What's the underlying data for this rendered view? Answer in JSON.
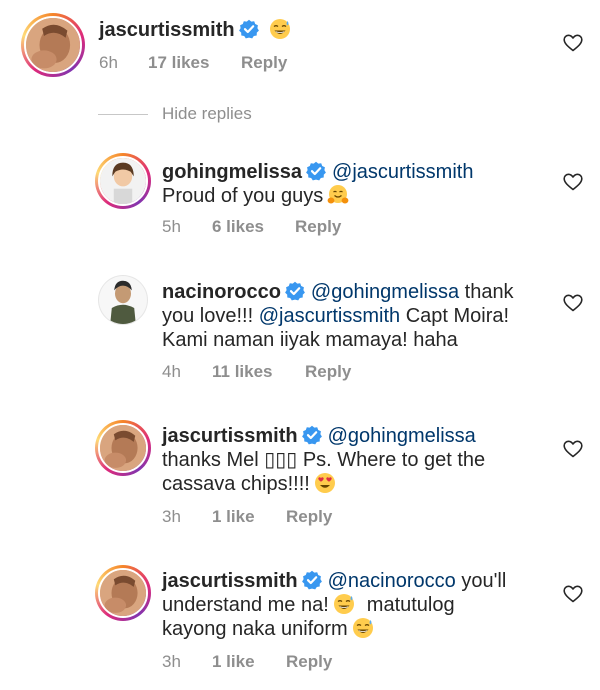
{
  "colors": {
    "text": "#262626",
    "meta": "#8e8e8e",
    "mention": "#00376b",
    "verified": "#3897f0"
  },
  "hide_replies": "Hide replies",
  "top_comment": {
    "username": "jascurtissmith",
    "emoji": "grinning-sweat-emoji",
    "time": "6h",
    "likes": "17 likes",
    "reply": "Reply"
  },
  "replies": [
    {
      "username": "gohingmelissa",
      "mention": "@jascurtissmith",
      "line2": "Proud of you guys",
      "emoji": "hugging-face-emoji",
      "time": "5h",
      "likes": "6 likes",
      "reply": "Reply"
    },
    {
      "username": "nacinorocco",
      "mention": "@gohingmelissa",
      "line1_tail": " thank",
      "line2_pre": "you love!!! ",
      "line2_mention": "@jascurtissmith",
      "line2_tail": " Capt Moira!",
      "line3": "Kami naman iiyak mamaya! haha",
      "time": "4h",
      "likes": "11 likes",
      "reply": "Reply"
    },
    {
      "username": "jascurtissmith",
      "mention": "@gohingmelissa",
      "line2": "thanks Mel ▯▯▯ Ps. Where to get the",
      "line3": "cassava chips!!!!",
      "emoji": "heart-eyes-emoji",
      "time": "3h",
      "likes": "1 like",
      "reply": "Reply"
    },
    {
      "username": "jascurtissmith",
      "mention": "@nacinorocco",
      "line1_tail": " you'll",
      "line2_pre": "understand me na!",
      "line2_tail": "matutulog",
      "line3": "kayong naka uniform",
      "time": "3h",
      "likes": "1 like",
      "reply": "Reply"
    }
  ]
}
